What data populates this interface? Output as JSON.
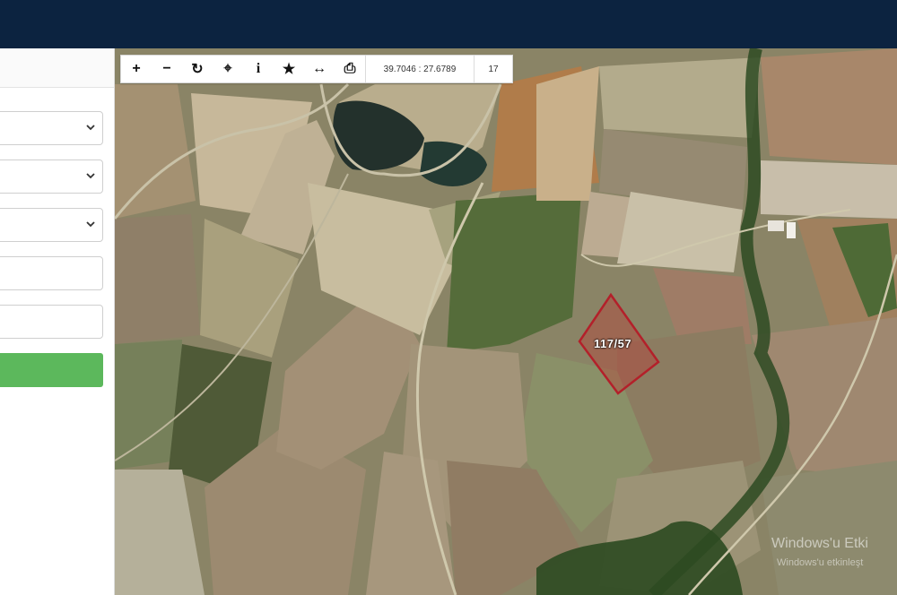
{
  "toolbar": {
    "buttons": [
      {
        "icon": "plus-icon",
        "glyph": "+"
      },
      {
        "icon": "minus-icon",
        "glyph": "−"
      },
      {
        "icon": "refresh-icon",
        "glyph": "↻"
      },
      {
        "icon": "crosshair-icon",
        "glyph": "⌖"
      },
      {
        "icon": "info-icon",
        "glyph": "i"
      },
      {
        "icon": "star-icon",
        "glyph": "★"
      },
      {
        "icon": "measure-icon",
        "glyph": "↔"
      },
      {
        "icon": "print-icon",
        "glyph": "⎙"
      }
    ],
    "coordinates": "39.7046 : 27.6789",
    "zoom": "17"
  },
  "map": {
    "parcel_label": "117/57",
    "parcel_color": "#b3202a"
  },
  "watermark": {
    "line1": "Windows'u Etki",
    "line2": "Windows'u etkinleşt"
  },
  "colors": {
    "topbar": "#0c2340",
    "accent_green": "#5cb85c"
  }
}
